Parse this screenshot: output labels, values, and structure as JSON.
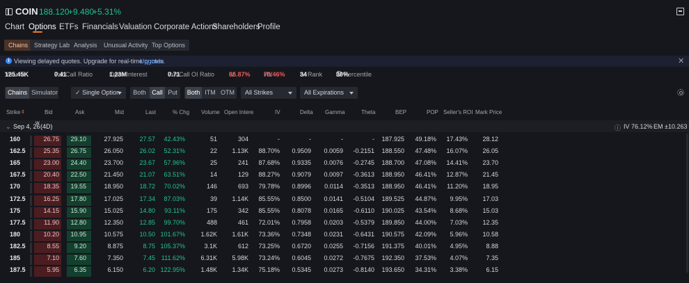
{
  "header": {
    "symbol": "COIN",
    "price": "188.120",
    "change": "+9.480",
    "change_pct": "+5.31%"
  },
  "nav": {
    "tabs": [
      "Chart",
      "Options",
      "ETFs",
      "Financials",
      "Valuation",
      "Corporate Actions",
      "Shareholders",
      "Profile"
    ],
    "active": "Options"
  },
  "subtabs": {
    "items": [
      "Chains",
      "Strategy Lab",
      "Analysis",
      "Unusual Activity",
      "Top Options"
    ],
    "active": "Chains"
  },
  "notice": {
    "text": "Viewing delayed quotes. Upgrade for real-time quotes.",
    "link": "Upgrade"
  },
  "stats": {
    "volume_label": "Volume",
    "volume": "125.45K",
    "pcr_label": "Put/Call Ratio",
    "pcr": "0.41",
    "oi_label": "Open Interest",
    "oi": "1.23M",
    "pcoi_label": "Put/Call OI Ratio",
    "pcoi": "0.71",
    "iv_label": "IV",
    "iv": "65.87%",
    "hv_label": "HV",
    "hv": "70.46%",
    "ivrank_label": "IV Rank",
    "ivrank": "34",
    "ivpct_label": "IV Percentile",
    "ivpct": "30%"
  },
  "filters": {
    "mode": [
      "Chains",
      "Simulator"
    ],
    "strategy": "Single Option",
    "side": [
      "Both",
      "Call",
      "Put"
    ],
    "money": [
      "Both",
      "ITM",
      "OTM"
    ],
    "strikes": "All Strikes",
    "expirations": "All Expirations"
  },
  "columns": [
    "Strike",
    "Bid",
    "Ask",
    "Mid",
    "Last",
    "% Chg",
    "Volume",
    "Open Intere",
    "IV",
    "Delta",
    "Gamma",
    "Theta",
    "BEP",
    "POP",
    "Seller's ROI",
    "Mark Price"
  ],
  "expiry": {
    "label": "Sep 4, 26",
    "sup": "W",
    "days": "(4D)",
    "iv": "IV 76.12%",
    "em": "EM ±10.263"
  },
  "rows": [
    {
      "strike": "160",
      "bid": "26.75",
      "ask": "29.10",
      "mid": "27.925",
      "last": "27.57",
      "pchg": "42.43%",
      "vol": "51",
      "oi": "304",
      "iv": "-",
      "delta": "-",
      "gamma": "-",
      "theta": "-",
      "bep": "187.925",
      "pop": "49.18%",
      "roi": "17.43%",
      "mark": "28.12"
    },
    {
      "strike": "162.5",
      "bid": "25.35",
      "ask": "26.75",
      "mid": "26.050",
      "last": "26.02",
      "pchg": "52.31%",
      "vol": "22",
      "oi": "1.13K",
      "iv": "88.70%",
      "delta": "0.9509",
      "gamma": "0.0059",
      "theta": "-0.2151",
      "bep": "188.550",
      "pop": "47.48%",
      "roi": "16.07%",
      "mark": "26.05"
    },
    {
      "strike": "165",
      "bid": "23.00",
      "ask": "24.40",
      "mid": "23.700",
      "last": "23.67",
      "pchg": "57.96%",
      "vol": "25",
      "oi": "241",
      "iv": "87.68%",
      "delta": "0.9335",
      "gamma": "0.0076",
      "theta": "-0.2745",
      "bep": "188.700",
      "pop": "47.08%",
      "roi": "14.41%",
      "mark": "23.70"
    },
    {
      "strike": "167.5",
      "bid": "20.40",
      "ask": "22.50",
      "mid": "21.450",
      "last": "21.07",
      "pchg": "63.51%",
      "vol": "14",
      "oi": "129",
      "iv": "88.27%",
      "delta": "0.9079",
      "gamma": "0.0097",
      "theta": "-0.3613",
      "bep": "188.950",
      "pop": "46.41%",
      "roi": "12.87%",
      "mark": "21.45"
    },
    {
      "strike": "170",
      "bid": "18.35",
      "ask": "19.55",
      "mid": "18.950",
      "last": "18.72",
      "pchg": "70.02%",
      "vol": "146",
      "oi": "693",
      "iv": "79.78%",
      "delta": "0.8996",
      "gamma": "0.0114",
      "theta": "-0.3513",
      "bep": "188.950",
      "pop": "46.41%",
      "roi": "11.20%",
      "mark": "18.95"
    },
    {
      "strike": "172.5",
      "bid": "16.25",
      "ask": "17.80",
      "mid": "17.025",
      "last": "17.34",
      "pchg": "87.03%",
      "vol": "39",
      "oi": "1.14K",
      "iv": "85.55%",
      "delta": "0.8500",
      "gamma": "0.0141",
      "theta": "-0.5104",
      "bep": "189.525",
      "pop": "44.87%",
      "roi": "9.95%",
      "mark": "17.03"
    },
    {
      "strike": "175",
      "bid": "14.15",
      "ask": "15.90",
      "mid": "15.025",
      "last": "14.80",
      "pchg": "93.11%",
      "vol": "175",
      "oi": "342",
      "iv": "85.55%",
      "delta": "0.8078",
      "gamma": "0.0165",
      "theta": "-0.6110",
      "bep": "190.025",
      "pop": "43.54%",
      "roi": "8.68%",
      "mark": "15.03"
    },
    {
      "strike": "177.5",
      "bid": "11.90",
      "ask": "12.80",
      "mid": "12.350",
      "last": "12.85",
      "pchg": "99.70%",
      "vol": "488",
      "oi": "461",
      "iv": "72.01%",
      "delta": "0.7958",
      "gamma": "0.0203",
      "theta": "-0.5379",
      "bep": "189.850",
      "pop": "44.00%",
      "roi": "7.03%",
      "mark": "12.35"
    },
    {
      "strike": "180",
      "bid": "10.20",
      "ask": "10.95",
      "mid": "10.575",
      "last": "10.50",
      "pchg": "101.67%",
      "vol": "1.62K",
      "oi": "1.61K",
      "iv": "73.36%",
      "delta": "0.7348",
      "gamma": "0.0231",
      "theta": "-0.6431",
      "bep": "190.575",
      "pop": "42.09%",
      "roi": "5.96%",
      "mark": "10.58"
    },
    {
      "strike": "182.5",
      "bid": "8.55",
      "ask": "9.20",
      "mid": "8.875",
      "last": "8.75",
      "pchg": "105.37%",
      "vol": "3.1K",
      "oi": "612",
      "iv": "73.25%",
      "delta": "0.6720",
      "gamma": "0.0255",
      "theta": "-0.7156",
      "bep": "191.375",
      "pop": "40.01%",
      "roi": "4.95%",
      "mark": "8.88"
    },
    {
      "strike": "185",
      "bid": "7.10",
      "ask": "7.60",
      "mid": "7.350",
      "last": "7.45",
      "pchg": "111.62%",
      "vol": "6.31K",
      "oi": "5.98K",
      "iv": "73.24%",
      "delta": "0.6045",
      "gamma": "0.0272",
      "theta": "-0.7675",
      "bep": "192.350",
      "pop": "37.53%",
      "roi": "4.07%",
      "mark": "7.35"
    },
    {
      "strike": "187.5",
      "bid": "5.95",
      "ask": "6.35",
      "mid": "6.150",
      "last": "6.20",
      "pchg": "122.95%",
      "vol": "1.48K",
      "oi": "1.34K",
      "iv": "75.18%",
      "delta": "0.5345",
      "gamma": "0.0273",
      "theta": "-0.8140",
      "bep": "193.650",
      "pop": "34.31%",
      "roi": "3.38%",
      "mark": "6.15"
    }
  ]
}
